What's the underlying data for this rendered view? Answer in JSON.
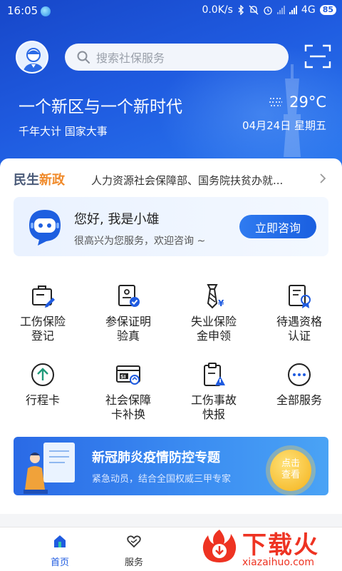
{
  "status_bar": {
    "time": "16:05",
    "network_speed": "0.0K/s",
    "network": "4G",
    "battery": "85"
  },
  "search": {
    "placeholder": "搜索社保服务"
  },
  "hero": {
    "slogan": "一个新区与一个新时代",
    "sub_slogan": "千年大计 国家大事",
    "temperature": "29°C",
    "date": "04月24日 星期五"
  },
  "news": {
    "tag_part1": "民生",
    "tag_part2": "新政",
    "text": "人力资源社会保障部、国务院扶贫办就..."
  },
  "assistant": {
    "greeting": "您好, 我是小雄",
    "welcome": "很高兴为您服务，欢迎咨询 ~",
    "button": "立即咨询"
  },
  "services": [
    {
      "label": "工伤保险\n登记",
      "icon": "id-card-edit-icon"
    },
    {
      "label": "参保证明\n验真",
      "icon": "certificate-verify-icon"
    },
    {
      "label": "失业保险\n金申领",
      "icon": "money-tie-icon"
    },
    {
      "label": "待遇资格\n认证",
      "icon": "document-badge-icon"
    },
    {
      "label": "行程卡",
      "icon": "arrow-up-circle-icon"
    },
    {
      "label": "社会保障\n卡补换",
      "icon": "si-card-exchange-icon"
    },
    {
      "label": "工伤事故\n快报",
      "icon": "clipboard-warning-icon"
    },
    {
      "label": "全部服务",
      "icon": "more-circle-icon"
    }
  ],
  "banner": {
    "title": "新冠肺炎疫情防控专题",
    "desc": "紧急动员，结合全国权威三甲专家",
    "cta_line1": "点击",
    "cta_line2": "查看"
  },
  "nav": [
    {
      "label": "首页",
      "icon": "home-icon",
      "active": true
    },
    {
      "label": "服务",
      "icon": "heart-hands-icon",
      "active": false
    }
  ],
  "watermark": {
    "text": "下载火",
    "url": "xiazaihuo.com"
  },
  "colors": {
    "primary": "#1f5be0",
    "accent_orange": "#f08a2a",
    "watermark_red": "#ee3322"
  }
}
